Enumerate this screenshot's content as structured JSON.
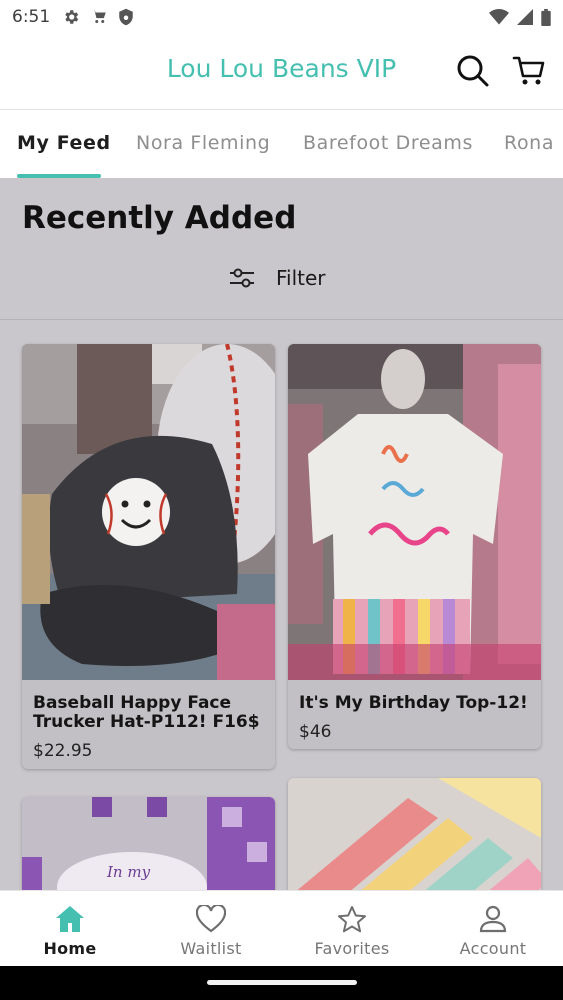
{
  "status_bar": {
    "time": "6:51"
  },
  "app_bar": {
    "title": "Lou Lou Beans VIP"
  },
  "tabs": [
    {
      "label": "My Feed",
      "active": true
    },
    {
      "label": "Nora Fleming",
      "active": false
    },
    {
      "label": "Barefoot Dreams",
      "active": false
    },
    {
      "label": "Rona",
      "active": false
    }
  ],
  "section": {
    "title": "Recently Added",
    "filter_label": "Filter"
  },
  "products": [
    {
      "title_line1": "Baseball Happy Face",
      "title_line2": "Trucker Hat-P112! F16$",
      "price": "$22.95"
    },
    {
      "title_line1": "It's My Birthday Top-12!",
      "price": "$46"
    }
  ],
  "bottom_nav": [
    {
      "label": "Home",
      "icon": "home-icon",
      "active": true
    },
    {
      "label": "Waitlist",
      "icon": "heart-icon",
      "active": false
    },
    {
      "label": "Favorites",
      "icon": "star-icon",
      "active": false
    },
    {
      "label": "Account",
      "icon": "person-icon",
      "active": false
    }
  ],
  "colors": {
    "accent": "#45bfb0",
    "content_bg": "#c9c7cb"
  }
}
